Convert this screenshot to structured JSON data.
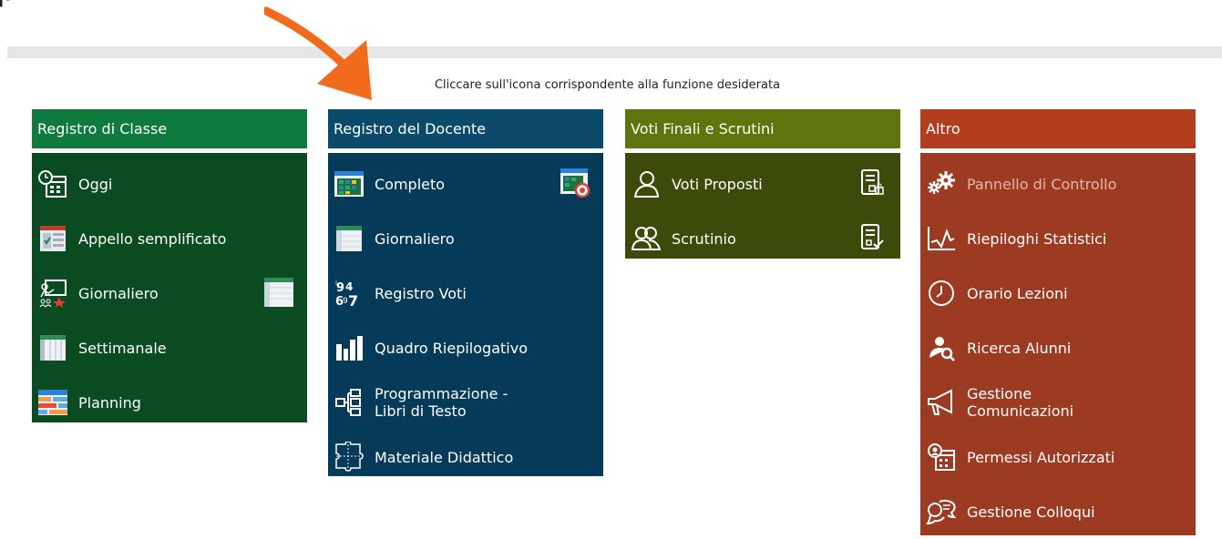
{
  "page": {
    "top_fragment": "p",
    "instruction": "Cliccare sull'icona corrispondente alla funzione desiderata"
  },
  "panels": [
    {
      "title": "Registro di Classe",
      "items": [
        {
          "label": "Oggi",
          "icon": "calendar-clock-icon"
        },
        {
          "label": "Appello semplificato",
          "icon": "attendance-list-icon"
        },
        {
          "label": "Giornaliero",
          "icon": "teacher-board-icon",
          "extra_icon": "grid-sheet-icon"
        },
        {
          "label": "Settimanale",
          "icon": "weekly-table-icon"
        },
        {
          "label": "Planning",
          "icon": "planning-table-icon"
        }
      ]
    },
    {
      "title": "Registro del Docente",
      "items": [
        {
          "label": "Completo",
          "icon": "colored-grid-icon",
          "extra_icon": "grid-target-icon"
        },
        {
          "label": "Giornaliero",
          "icon": "sheet-icon"
        },
        {
          "label": "Registro Voti",
          "icon": "grades-numbers-icon"
        },
        {
          "label": "Quadro Riepilogativo",
          "icon": "bar-chart-icon"
        },
        {
          "label": "Programmazione - Libri di Testo",
          "line1": "Programmazione -",
          "line2": "Libri di Testo",
          "icon": "hierarchy-icon"
        },
        {
          "label": "Materiale Didattico",
          "icon": "puzzle-icon"
        }
      ]
    },
    {
      "title": "Voti Finali e Scrutini",
      "items": [
        {
          "label": "Voti Proposti",
          "icon": "user-outline-icon",
          "extra_icon": "document-lock-icon"
        },
        {
          "label": "Scrutinio",
          "icon": "users-outline-icon",
          "extra_icon": "document-check-icon"
        }
      ]
    },
    {
      "title": "Altro",
      "items": [
        {
          "label": "Pannello di Controllo",
          "icon": "gears-icon",
          "disabled": true
        },
        {
          "label": "Riepiloghi Statistici",
          "icon": "stats-chart-icon"
        },
        {
          "label": "Orario Lezioni",
          "icon": "clock-icon"
        },
        {
          "label": "Ricerca Alunni",
          "icon": "user-search-icon"
        },
        {
          "label": "Gestione Comunicazioni",
          "line1": "Gestione",
          "line2": "Comunicazioni",
          "icon": "megaphone-icon"
        },
        {
          "label": "Permessi Autorizzati",
          "icon": "permit-calendar-icon"
        },
        {
          "label": "Gestione Colloqui",
          "icon": "chat-bubbles-icon"
        }
      ]
    }
  ],
  "colors": {
    "registro_classe_header": "#0e7a3e",
    "registro_classe_body": "#0a4b22",
    "registro_docente_header": "#0b4a6a",
    "registro_docente_body": "#053a58",
    "voti_header": "#5e740d",
    "voti_body": "#3d4b0a",
    "altro_header": "#b33d1f",
    "altro_body": "#9c3a22",
    "arrow": "#f26a1b"
  }
}
